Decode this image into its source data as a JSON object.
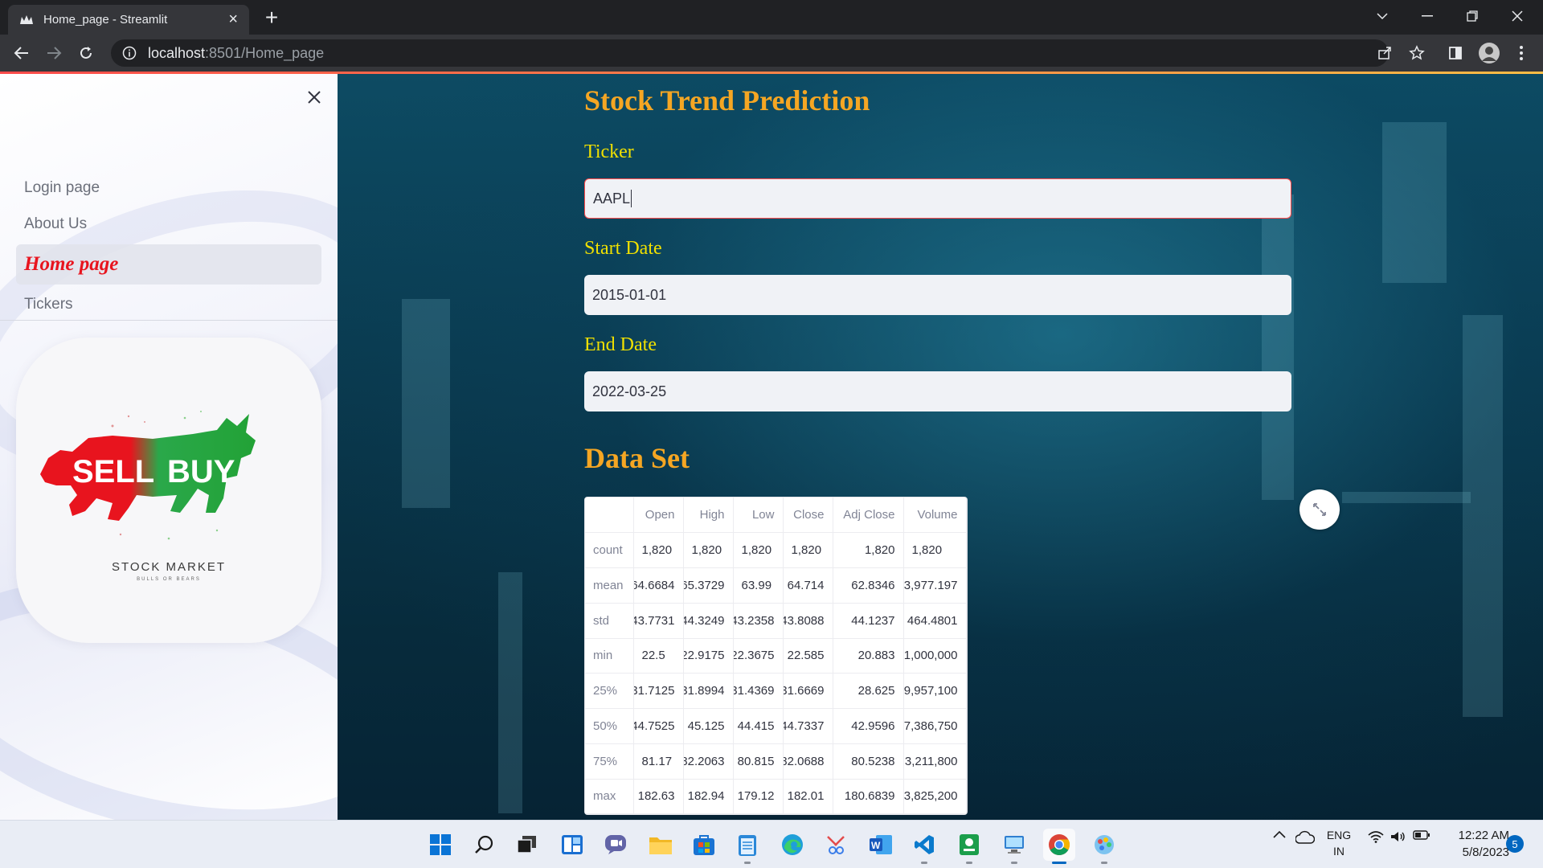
{
  "browser": {
    "tab_title": "Home_page - Streamlit",
    "url_host": "localhost",
    "url_path": ":8501/Home_page"
  },
  "sidebar": {
    "items": [
      {
        "label": "Login page",
        "active": false
      },
      {
        "label": "About Us",
        "active": false
      },
      {
        "label": "Home page",
        "active": true
      },
      {
        "label": "Tickers",
        "active": false
      }
    ],
    "logo": {
      "sell": "SELL",
      "buy": "BUY",
      "caption": "STOCK MARKET",
      "subcaption": "BULLS OR BEARS"
    }
  },
  "main": {
    "title": "Stock Trend Prediction",
    "ticker_label": "Ticker",
    "ticker_value": "AAPL",
    "start_label": "Start Date",
    "start_value": "2015-01-01",
    "end_label": "End Date",
    "end_value": "2022-03-25",
    "dataset_title": "Data Set"
  },
  "dataframe": {
    "columns": [
      "",
      "Open",
      "High",
      "Low",
      "Close",
      "Adj Close",
      "Volume"
    ],
    "rows": [
      [
        "count",
        "1,820",
        "1,820",
        "1,820",
        "1,820",
        "1,820",
        "1,820"
      ],
      [
        "mean",
        "64.6684",
        "65.3729",
        "63.99",
        "64.714",
        "62.8346",
        "3,977.197"
      ],
      [
        "std",
        "43.7731",
        "44.3249",
        "43.2358",
        "43.8088",
        "44.1237",
        "464.4801"
      ],
      [
        "min",
        "22.5",
        "22.9175",
        "22.3675",
        "22.585",
        "20.883",
        "1,000,000"
      ],
      [
        "25%",
        "31.7125",
        "31.8994",
        "31.4369",
        "31.6669",
        "28.625",
        "9,957,100"
      ],
      [
        "50%",
        "44.7525",
        "45.125",
        "44.415",
        "44.7337",
        "42.9596",
        "7,386,750"
      ],
      [
        "75%",
        "81.17",
        "82.2063",
        "80.815",
        "82.0688",
        "80.5238",
        "3,211,800"
      ],
      [
        "max",
        "182.63",
        "182.94",
        "179.12",
        "182.01",
        "180.6839",
        "3,825,200"
      ]
    ]
  },
  "taskbar": {
    "lang_top": "ENG",
    "lang_bottom": "IN",
    "time": "12:22 AM",
    "date": "5/8/2023",
    "notif_count": "5"
  },
  "colors": {
    "title_orange": "#f5a623",
    "label_yellow": "#f0e000",
    "active_red": "#e8141e",
    "accent_red": "#ff4b4b"
  }
}
